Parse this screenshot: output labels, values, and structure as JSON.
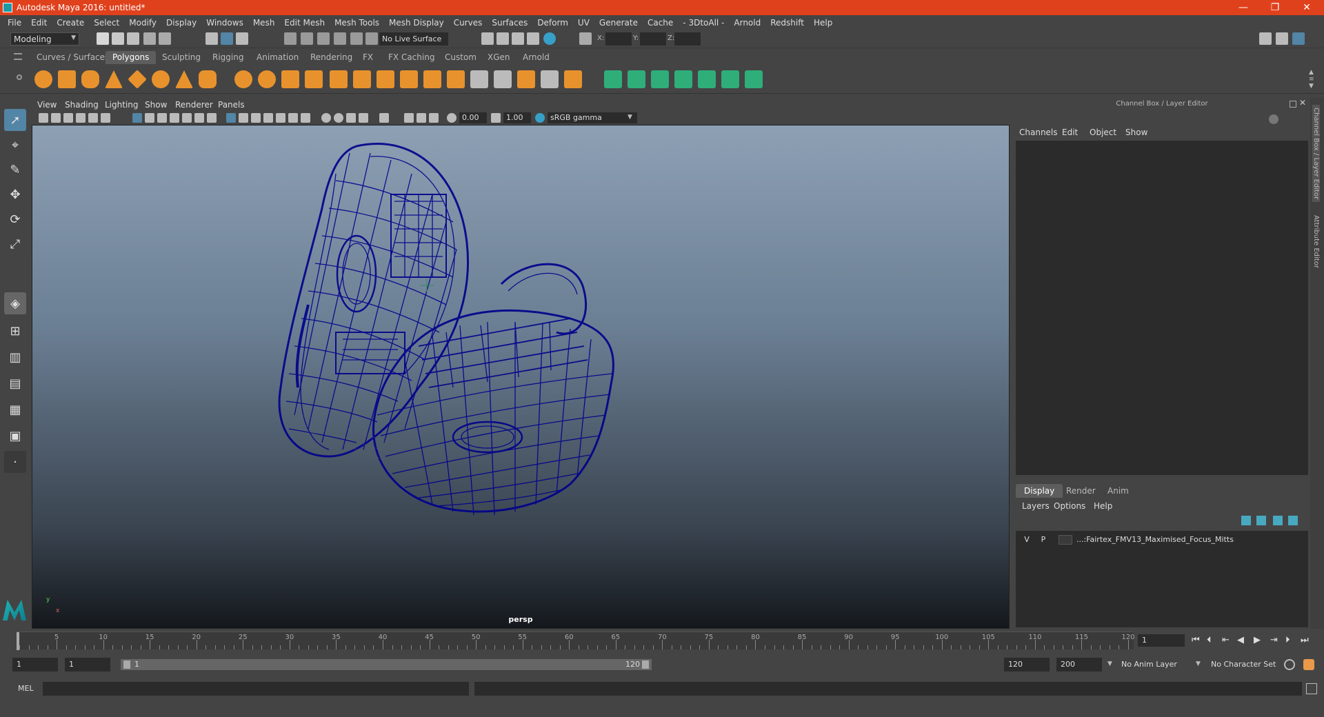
{
  "window": {
    "title": "Autodesk Maya 2016: untitled*",
    "controls": [
      "—",
      "❐",
      "✕"
    ]
  },
  "menus": [
    "File",
    "Edit",
    "Create",
    "Select",
    "Modify",
    "Display",
    "Windows",
    "Mesh",
    "Edit Mesh",
    "Mesh Tools",
    "Mesh Display",
    "Curves",
    "Surfaces",
    "Deform",
    "UV",
    "Generate",
    "Cache",
    "- 3DtoAll -",
    "Arnold",
    "Redshift",
    "Help"
  ],
  "status_line": {
    "mode": "Modeling",
    "live_surface": "No Live Surface",
    "x_label": "X:",
    "y_label": "Y:",
    "z_label": "Z:"
  },
  "shelf_tabs": [
    "Curves / Surfaces",
    "Polygons",
    "Sculpting",
    "Rigging",
    "Animation",
    "Rendering",
    "FX",
    "FX Caching",
    "Custom",
    "XGen",
    "Arnold"
  ],
  "shelf_active": "Polygons",
  "panel_menu": [
    "View",
    "Shading",
    "Lighting",
    "Show",
    "Renderer",
    "Panels"
  ],
  "panel_toolbar": {
    "exposure": "0.00",
    "gamma": "1.00",
    "color_space": "sRGB gamma"
  },
  "viewport": {
    "camera": "persp",
    "axis_y": "y",
    "axis_x": "x"
  },
  "channel_box": {
    "header": "Channel Box / Layer Editor",
    "menus": [
      "Channels",
      "Edit",
      "Object",
      "Show"
    ]
  },
  "layer_editor": {
    "tabs": [
      "Display",
      "Render",
      "Anim"
    ],
    "active_tab": "Display",
    "menus": [
      "Layers",
      "Options",
      "Help"
    ],
    "layer": {
      "visible": "V",
      "playback": "P",
      "name": "...:Fairtex_FMV13_Maximised_Focus_Mitts"
    }
  },
  "side_tabs": [
    "Channel Box / Layer Editor",
    "Attribute Editor"
  ],
  "time_slider": {
    "ticks": [
      5,
      10,
      15,
      20,
      25,
      30,
      35,
      40,
      45,
      50,
      55,
      60,
      65,
      70,
      75,
      80,
      85,
      90,
      95,
      100,
      105,
      110,
      115,
      120
    ],
    "start_label": "1",
    "current_frame": "1"
  },
  "range_slider": {
    "start": "1",
    "playback_start": "1",
    "range_start_label": "1",
    "range_end_label": "120",
    "playback_end": "120",
    "end": "200",
    "anim_layer": "No Anim Layer",
    "character_set": "No Character Set"
  },
  "command_line": {
    "label": "MEL"
  },
  "colors": {
    "titlebar": "#e0411d",
    "wireframe": "#00008b",
    "active_tool": "#5285a6"
  }
}
